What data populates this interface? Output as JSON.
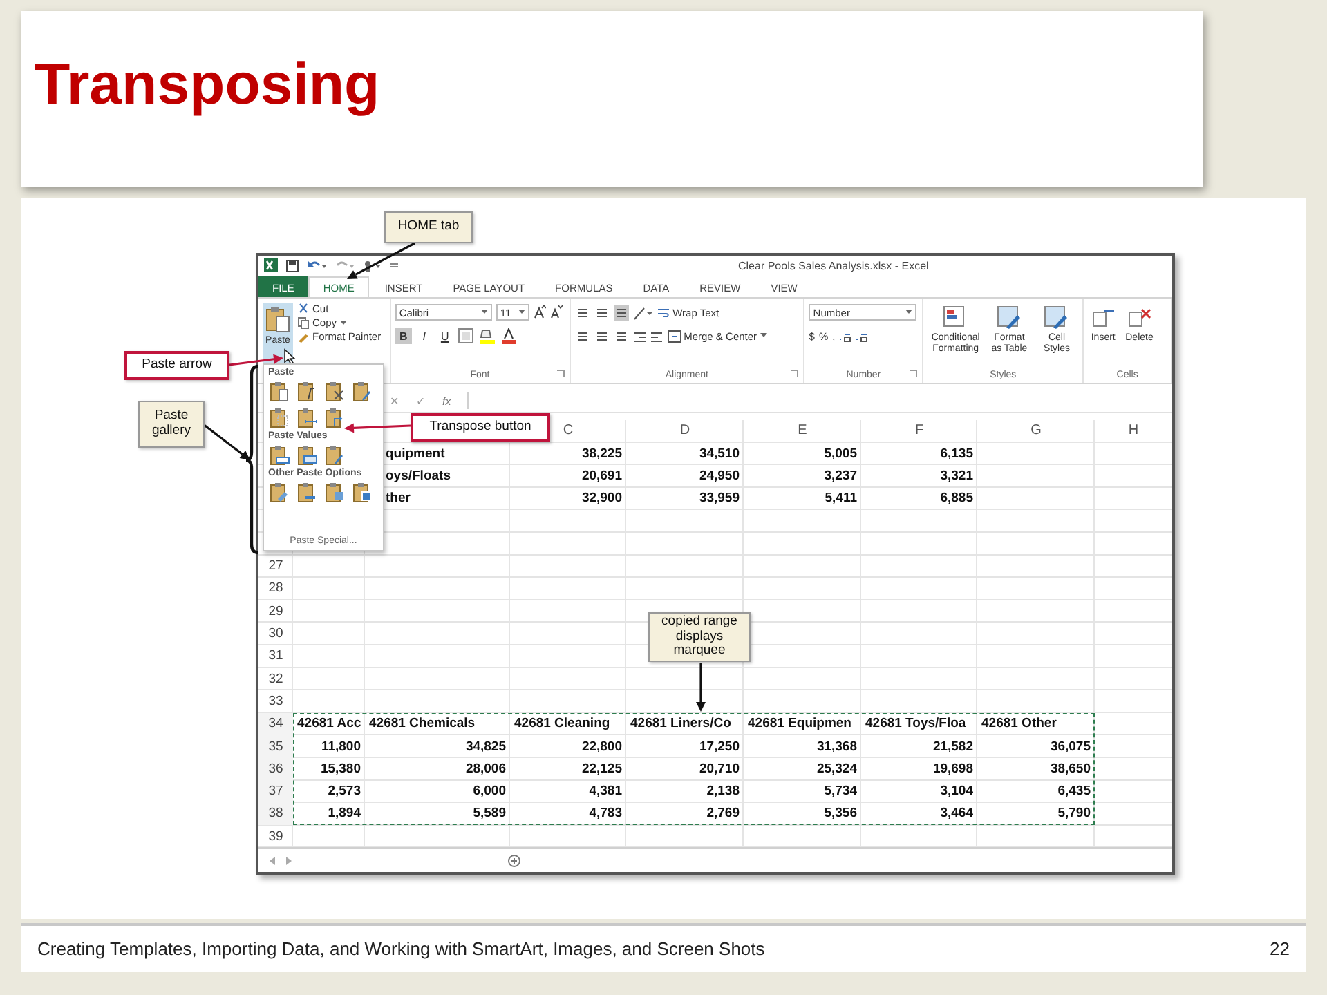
{
  "slide": {
    "title": "Transposing",
    "footer": "Creating Templates, Importing Data, and Working with SmartArt, Images, and Screen Shots",
    "page_number": "22"
  },
  "excel": {
    "window_title": "Clear Pools Sales Analysis.xlsx - Excel",
    "tabs": [
      {
        "label": "FILE",
        "kind": "file",
        "selected": false
      },
      {
        "label": "HOME",
        "kind": "tab",
        "selected": true
      },
      {
        "label": "INSERT",
        "kind": "tab",
        "selected": false
      },
      {
        "label": "PAGE LAYOUT",
        "kind": "tab",
        "selected": false
      },
      {
        "label": "FORMULAS",
        "kind": "tab",
        "selected": false
      },
      {
        "label": "DATA",
        "kind": "tab",
        "selected": false
      },
      {
        "label": "REVIEW",
        "kind": "tab",
        "selected": false
      },
      {
        "label": "VIEW",
        "kind": "tab",
        "selected": false
      }
    ],
    "clipboard": {
      "paste": {
        "label": "Paste",
        "highlighted": true
      },
      "items": [
        "Cut",
        "Copy",
        "Format Painter"
      ]
    },
    "font": {
      "name": "Calibri",
      "size": "11",
      "styles": [
        {
          "label": "B",
          "on": true
        },
        {
          "label": "I",
          "on": false
        },
        {
          "label": "U",
          "on": false
        }
      ]
    },
    "alignment": {
      "vertical": [
        {
          "selected": false
        },
        {
          "selected": false
        },
        {
          "selected": true
        }
      ],
      "wrap_text": "Wrap Text",
      "merge": "Merge & Center"
    },
    "number": {
      "format": "Number",
      "symbols": [
        "$",
        "%",
        ","
      ]
    },
    "styles": [
      "Conditional Formatting",
      "Format as Table",
      "Cell Styles"
    ],
    "cells": [
      "Insert",
      "Delete"
    ],
    "group_labels": [
      "Font",
      "Alignment",
      "Number",
      "Styles",
      "Cells"
    ],
    "formula_bar": {
      "cancel": "✕",
      "enter": "✓",
      "function": "fx"
    },
    "columns": [
      "C",
      "D",
      "E",
      "F",
      "G",
      "H"
    ],
    "covered_rows": [
      {
        "cells": {
          "B": {
            "kind": "text",
            "text": "quipment"
          },
          "C": {
            "kind": "number",
            "text": "38,225"
          },
          "D": {
            "kind": "number",
            "text": "34,510"
          },
          "E": {
            "kind": "number",
            "text": "5,005"
          },
          "F": {
            "kind": "number",
            "text": "6,135"
          }
        }
      },
      {
        "cells": {
          "B": {
            "kind": "text",
            "text": "oys/Floats"
          },
          "C": {
            "kind": "number",
            "text": "20,691"
          },
          "D": {
            "kind": "number",
            "text": "24,950"
          },
          "E": {
            "kind": "number",
            "text": "3,237"
          },
          "F": {
            "kind": "number",
            "text": "3,321"
          }
        }
      },
      {
        "cells": {
          "B": {
            "kind": "text",
            "text": "ther"
          },
          "C": {
            "kind": "number",
            "text": "32,900"
          },
          "D": {
            "kind": "number",
            "text": "33,959"
          },
          "E": {
            "kind": "number",
            "text": "5,411"
          },
          "F": {
            "kind": "number",
            "text": "6,885"
          }
        }
      }
    ],
    "rows": [
      {
        "number": "27",
        "copied": false
      },
      {
        "number": "28",
        "copied": false
      },
      {
        "number": "29",
        "copied": false
      },
      {
        "number": "30",
        "copied": false
      },
      {
        "number": "31",
        "copied": false
      },
      {
        "number": "32",
        "copied": false
      },
      {
        "number": "33",
        "copied": false
      },
      {
        "number": "34",
        "copied": true,
        "cells": {
          "A": {
            "kind": "text",
            "text": "42681 Acc"
          },
          "B": {
            "kind": "text",
            "text": "42681 Chemicals"
          },
          "C": {
            "kind": "text",
            "text": "42681 Cleaning"
          },
          "D": {
            "kind": "text",
            "text": "42681 Liners/Co"
          },
          "E": {
            "kind": "text",
            "text": "42681 Equipmen"
          },
          "F": {
            "kind": "text",
            "text": "42681 Toys/Floa"
          },
          "G": {
            "kind": "text",
            "text": "42681 Other"
          }
        }
      },
      {
        "number": "35",
        "copied": true,
        "cells": {
          "A": {
            "kind": "number",
            "text": "11,800"
          },
          "B": {
            "kind": "number",
            "text": "34,825"
          },
          "C": {
            "kind": "number",
            "text": "22,800"
          },
          "D": {
            "kind": "number",
            "text": "17,250"
          },
          "E": {
            "kind": "number",
            "text": "31,368"
          },
          "F": {
            "kind": "number",
            "text": "21,582"
          },
          "G": {
            "kind": "number",
            "text": "36,075"
          }
        }
      },
      {
        "number": "36",
        "copied": true,
        "cells": {
          "A": {
            "kind": "number",
            "text": "15,380"
          },
          "B": {
            "kind": "number",
            "text": "28,006"
          },
          "C": {
            "kind": "number",
            "text": "22,125"
          },
          "D": {
            "kind": "number",
            "text": "20,710"
          },
          "E": {
            "kind": "number",
            "text": "25,324"
          },
          "F": {
            "kind": "number",
            "text": "19,698"
          },
          "G": {
            "kind": "number",
            "text": "38,650"
          }
        }
      },
      {
        "number": "37",
        "copied": true,
        "cells": {
          "A": {
            "kind": "number",
            "text": "2,573"
          },
          "B": {
            "kind": "number",
            "text": "6,000"
          },
          "C": {
            "kind": "number",
            "text": "4,381"
          },
          "D": {
            "kind": "number",
            "text": "2,138"
          },
          "E": {
            "kind": "number",
            "text": "5,734"
          },
          "F": {
            "kind": "number",
            "text": "3,104"
          },
          "G": {
            "kind": "number",
            "text": "6,435"
          }
        }
      },
      {
        "number": "38",
        "copied": true,
        "cells": {
          "A": {
            "kind": "number",
            "text": "1,894"
          },
          "B": {
            "kind": "number",
            "text": "5,589"
          },
          "C": {
            "kind": "number",
            "text": "4,783"
          },
          "D": {
            "kind": "number",
            "text": "2,769"
          },
          "E": {
            "kind": "number",
            "text": "5,356"
          },
          "F": {
            "kind": "number",
            "text": "3,464"
          },
          "G": {
            "kind": "number",
            "text": "5,790"
          }
        }
      },
      {
        "number": "39",
        "copied": false
      }
    ]
  },
  "paste_gallery": {
    "sections": [
      {
        "heading": "Paste",
        "buttons": [
          {
            "kind": "paste"
          },
          {
            "kind": "formulas"
          },
          {
            "kind": "formulas-number"
          },
          {
            "kind": "keep-source"
          },
          {
            "kind": "no-borders"
          },
          {
            "kind": "column-widths"
          },
          {
            "kind": "transpose"
          }
        ]
      },
      {
        "heading": "Paste Values",
        "buttons": [
          {
            "kind": "values"
          },
          {
            "kind": "values-number"
          },
          {
            "kind": "values-source"
          }
        ]
      },
      {
        "heading": "Other Paste Options",
        "buttons": [
          {
            "kind": "formatting"
          },
          {
            "kind": "link"
          },
          {
            "kind": "picture"
          },
          {
            "kind": "linked-picture"
          }
        ]
      }
    ],
    "footer": "Paste Special..."
  },
  "callouts": [
    {
      "text": "HOME tab",
      "kind": "note"
    },
    {
      "text": "Paste arrow",
      "kind": "highlight"
    },
    {
      "text": "Paste gallery",
      "kind": "note"
    },
    {
      "text": "Transpose button",
      "kind": "highlight"
    },
    {
      "text": "copied range displays marquee",
      "kind": "note"
    }
  ]
}
